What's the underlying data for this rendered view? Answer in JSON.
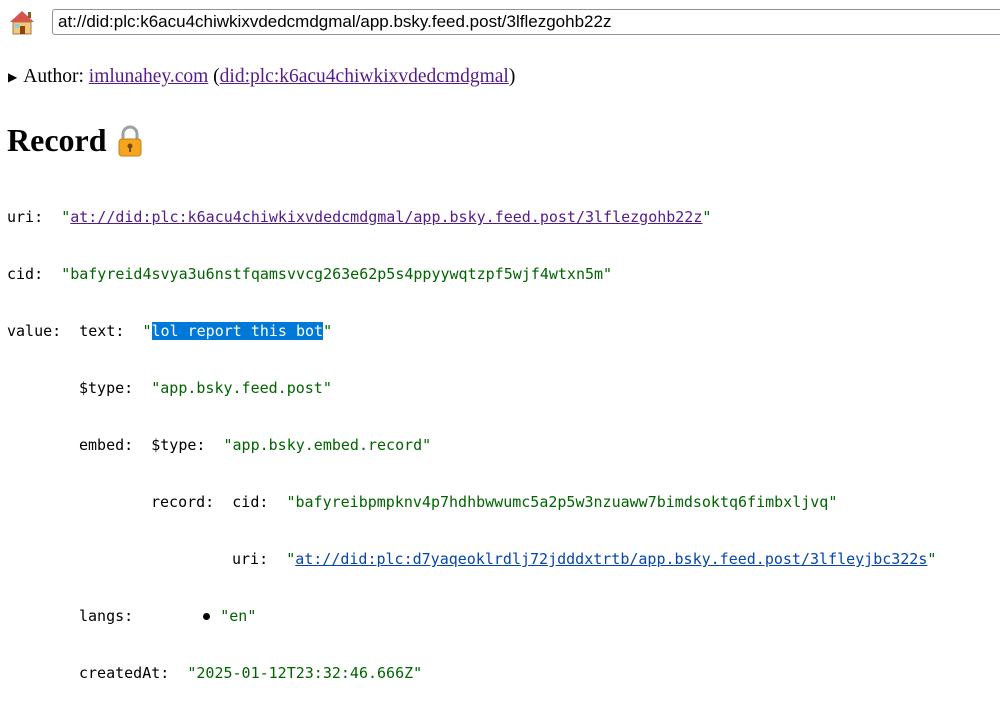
{
  "nav": {
    "url": "at://did:plc:k6acu4chiwkixvdedcmdgmal/app.bsky.feed.post/3lflezgohb22z",
    "home_icon": "home-icon"
  },
  "author": {
    "label": "Author:",
    "handle": "imlunahey.com",
    "open_paren": "(",
    "did": "did:plc:k6acu4chiwkixvdedcmdgmal",
    "close_paren": ")"
  },
  "heading": {
    "title": "Record",
    "lock_icon": "lock-icon"
  },
  "record": {
    "uri_key": "uri:",
    "uri_value": "at://did:plc:k6acu4chiwkixvdedcmdgmal/app.bsky.feed.post/3lflezgohb22z",
    "cid_key": "cid:",
    "cid_value": "\"bafyreid4svya3u6nstfqamsvvcg263e62p5s4ppyywqtzpf5wjf4wtxn5m\"",
    "value_key": "value:",
    "text_key": "text:",
    "text_value": "lol report this bot",
    "type_key": "$type:",
    "type_value": "\"app.bsky.feed.post\"",
    "embed_key": "embed:",
    "embed_type_key": "$type:",
    "embed_type_value": "\"app.bsky.embed.record\"",
    "record_key": "record:",
    "record_cid_key": "cid:",
    "record_cid_value": "\"bafyreibpmpknv4p7hdhbwwumc5a2p5w3nzuaww7bimdsoktq6fimbxljvq\"",
    "record_uri_key": "uri:",
    "record_uri_value": "at://did:plc:d7yaqeoklrdlj72jdddxtrtb/app.bsky.feed.post/3lfleyjbc322s",
    "langs_key": "langs:",
    "langs": [
      "\"en\""
    ],
    "created_key": "createdAt:",
    "created_value": "\"2025-01-12T23:32:46.666Z\""
  },
  "colors": {
    "string": "#006400",
    "visited_link": "#551a8b",
    "link": "#0645ad",
    "selection": "#0078d7"
  }
}
